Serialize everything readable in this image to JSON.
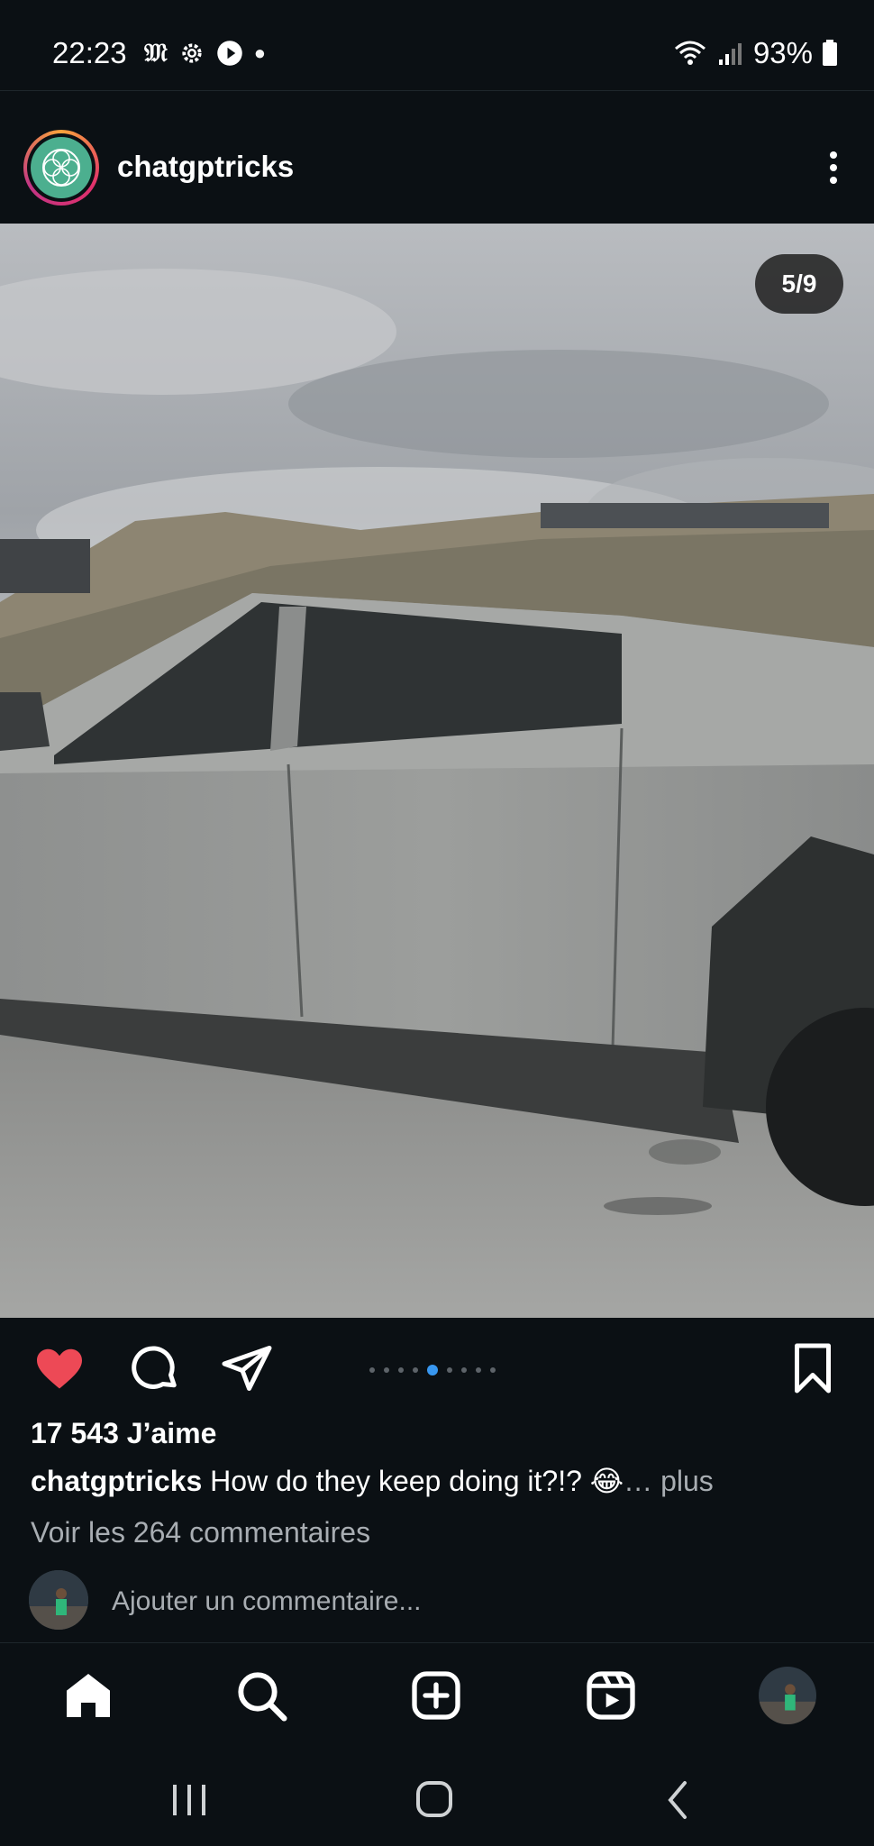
{
  "status_bar": {
    "time": "22:23",
    "battery": "93%",
    "icons": [
      "newspaper-icon",
      "settings-icon",
      "play-icon",
      "dot-icon",
      "wifi-icon",
      "signal-icon",
      "battery-icon"
    ]
  },
  "post": {
    "username": "chatgptricks",
    "counter": "5/9",
    "current_slide": 5,
    "total_slides": 9,
    "likes": "17 543 J’aime",
    "caption_user": "chatgptricks",
    "caption_text": "How do they keep doing it?!? 😂",
    "caption_more": "… plus",
    "comments_link": "Voir les 264 commentaires",
    "add_comment_placeholder": "Ajouter un commentaire...",
    "liked": true
  },
  "colors": {
    "background": "#0b1014",
    "like": "#ed4956",
    "active_dot": "#3897f0",
    "muted_text": "#a8adb2"
  },
  "bottom_nav": [
    "home-icon",
    "search-icon",
    "create-icon",
    "reels-icon",
    "profile-avatar"
  ]
}
